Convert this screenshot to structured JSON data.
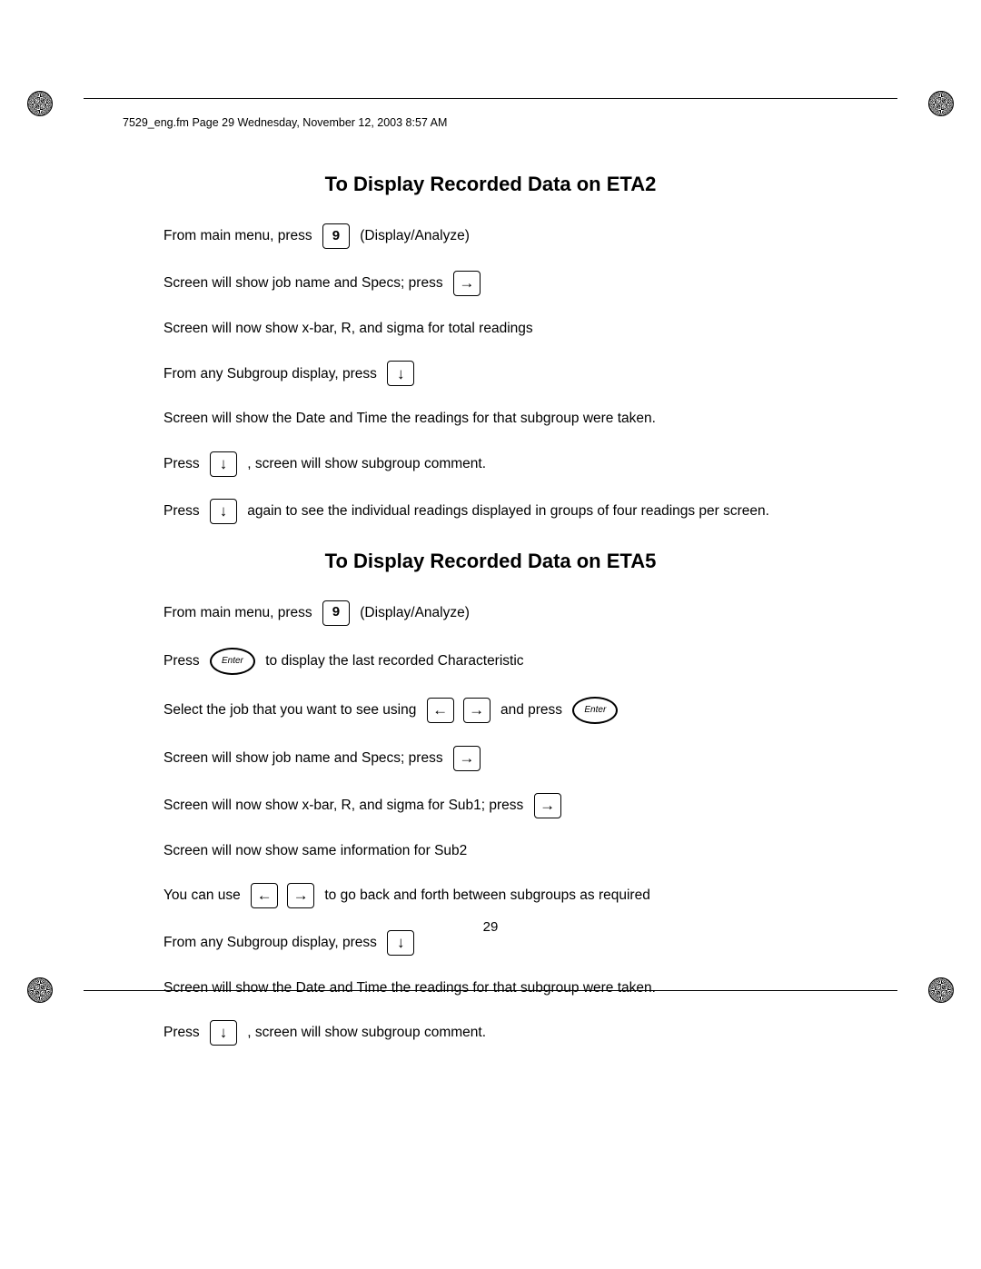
{
  "header": "7529_eng.fm  Page 29  Wednesday, November 12, 2003  8:57 AM",
  "page_number": "29",
  "sec1": {
    "heading": "To Display Recorded Data on ETA2",
    "l1a": "From main menu, press ",
    "l1key": "9",
    "l1b": " (Display/Analyze)",
    "l2a": "Screen will show job name and Specs; press ",
    "l3": "Screen will now show x-bar, R, and sigma for total readings",
    "l4a": "From any Subgroup display, press ",
    "l5": "Screen will show the Date and Time the readings for that subgroup were taken.",
    "l6a": "Press ",
    "l6b": " , screen will show subgroup comment.",
    "l7a": "Press ",
    "l7b": " again to see the individual readings displayed in groups of four readings per screen."
  },
  "sec2": {
    "heading": "To Display Recorded Data on ETA5",
    "l1a": "From main menu, press ",
    "l1key": "9",
    "l1b": " (Display/Analyze)",
    "l2a": "Press ",
    "l2enter": "Enter",
    "l2b": " to display the last recorded Characteristic",
    "l3a": "Select the job that you want to see using ",
    "l3b": " and press ",
    "l3enter": "Enter",
    "l4a": "Screen will show job name and Specs; press ",
    "l5a": "Screen will now show x-bar, R, and sigma for Sub1; press ",
    "l6": "Screen will now show same information for Sub2",
    "l7a": "You can use ",
    "l7b": " to go back and forth between subgroups as required",
    "l8a": "From any Subgroup display, press ",
    "l9": "Screen will show the Date and Time the readings for that subgroup were taken.",
    "l10a": "Press ",
    "l10b": " , screen will show subgroup comment."
  },
  "arrows": {
    "right": "→",
    "left": "←",
    "down": "↓"
  }
}
